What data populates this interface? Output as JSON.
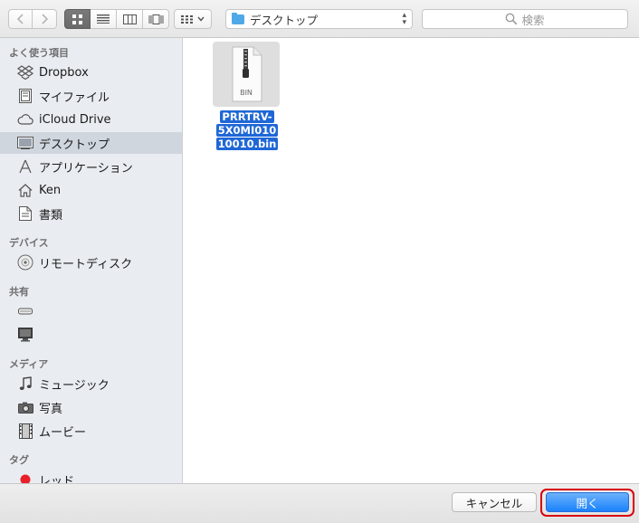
{
  "toolbar": {
    "location": "デスクトップ",
    "search_placeholder": "検索"
  },
  "sidebar": {
    "favorites_title": "よく使う項目",
    "favorites": [
      {
        "label": "Dropbox",
        "icon": "dropbox-icon"
      },
      {
        "label": "マイファイル",
        "icon": "my-files-icon"
      },
      {
        "label": "iCloud Drive",
        "icon": "icloud-icon"
      },
      {
        "label": "デスクトップ",
        "icon": "desktop-icon",
        "selected": true
      },
      {
        "label": "アプリケーション",
        "icon": "applications-icon"
      },
      {
        "label": "Ken",
        "icon": "home-icon"
      },
      {
        "label": "書類",
        "icon": "documents-icon"
      }
    ],
    "devices_title": "デバイス",
    "devices": [
      {
        "label": "リモートディスク",
        "icon": "remote-disc-icon"
      }
    ],
    "shared_title": "共有",
    "shared": [
      {
        "label": "",
        "icon": "server-icon"
      },
      {
        "label": "",
        "icon": "computer-icon"
      }
    ],
    "media_title": "メディア",
    "media": [
      {
        "label": "ミュージック",
        "icon": "music-icon"
      },
      {
        "label": "写真",
        "icon": "camera-icon"
      },
      {
        "label": "ムービー",
        "icon": "film-icon"
      }
    ],
    "tags_title": "タグ",
    "tags": [
      {
        "label": "レッド",
        "icon": "red-tag-icon",
        "color": "#e8202a"
      }
    ]
  },
  "files": [
    {
      "name_line1": "PRRTRV-5X0MI010",
      "name_line2": "10010.bin",
      "badge": "BIN",
      "selected": true
    }
  ],
  "buttons": {
    "cancel": "キャンセル",
    "open": "開く"
  },
  "colors": {
    "accent": "#1a82fb",
    "highlight_ring": "#d8000f",
    "selection": "#1f67d6"
  }
}
